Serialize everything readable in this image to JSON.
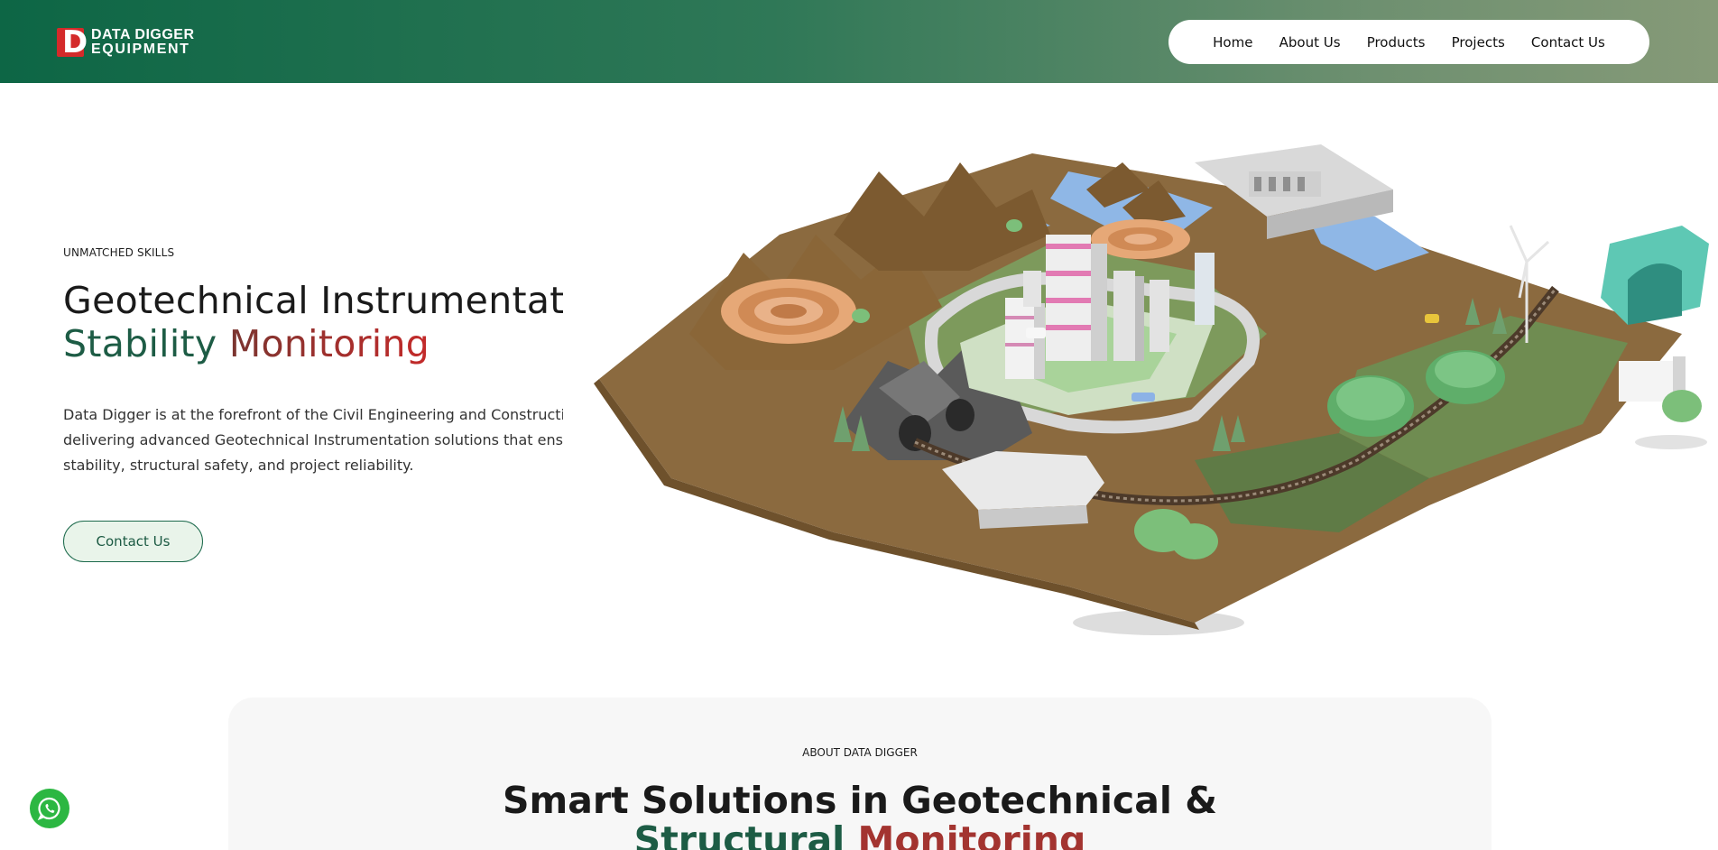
{
  "brand": {
    "logo_mark": "D",
    "line1": "DATA DIGGER",
    "line2": "EQUIPMENT",
    "primary_color": "#0d6645",
    "accent_color": "#d42a2a"
  },
  "nav": {
    "items": [
      {
        "label": "Home"
      },
      {
        "label": "About Us"
      },
      {
        "label": "Products"
      },
      {
        "label": "Projects"
      },
      {
        "label": "Contact Us"
      }
    ]
  },
  "hero": {
    "eyebrow": "UNMATCHED SKILLS",
    "title_part1": "Geotechnical Instrumentation for",
    "title_green": "Stability",
    "title_red": "Monitoring",
    "description": "Data Digger is at the forefront of the Civil Engineering and Construction industry, delivering advanced Geotechnical Instrumentation solutions that ensure ground stability, structural safety, and project reliability.",
    "cta_label": "Contact Us"
  },
  "about": {
    "eyebrow": "ABOUT DATA DIGGER",
    "title_part1": "Smart Solutions in Geotechnical &",
    "title_green": "Structural",
    "title_red": "Monitoring"
  },
  "floating": {
    "whatsapp_icon": "whatsapp-icon",
    "whatsapp_color": "#2cb742"
  }
}
